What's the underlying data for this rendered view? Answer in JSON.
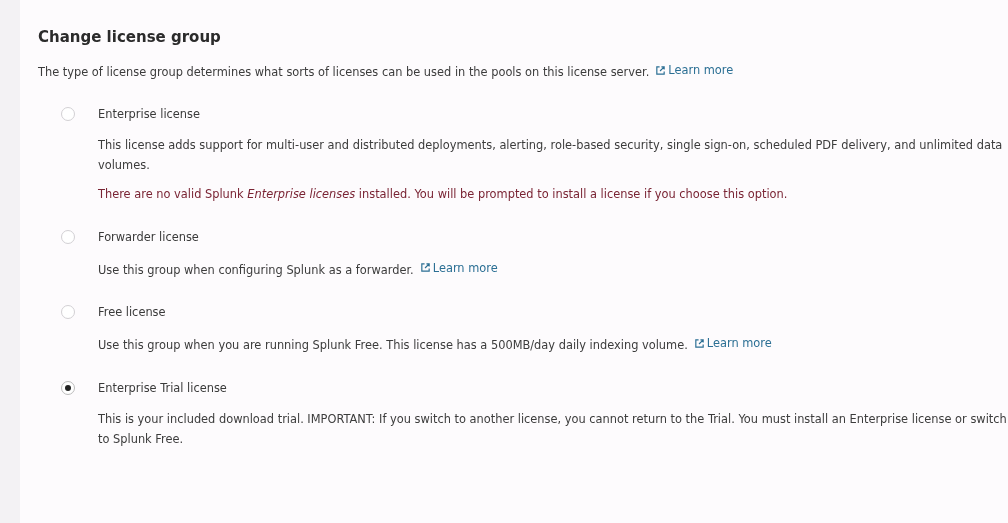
{
  "title": "Change license group",
  "intro": {
    "text": "The type of license group determines what sorts of licenses can be used in the pools on this license server.",
    "link": "Learn more"
  },
  "options": [
    {
      "label": "Enterprise license",
      "selected": false,
      "description": "This license adds support for multi-user and distributed deployments, alerting, role-based security, single sign-on, scheduled PDF delivery, and unlimited data volumes.",
      "warning": "There are no valid Splunk *Enterprise licenses* installed. You will be prompted to install a license if you choose this option."
    },
    {
      "label": "Forwarder license",
      "selected": false,
      "description": "Use this group when configuring Splunk as a forwarder.",
      "link": "Learn more"
    },
    {
      "label": "Free license",
      "selected": false,
      "description": "Use this group when you are running Splunk Free. This license has a 500MB/day daily indexing volume.",
      "link": "Learn more"
    },
    {
      "label": "Enterprise Trial license",
      "selected": true,
      "description": "This is your included download trial. IMPORTANT: If you switch to another license, you cannot return to the Trial. You must install an Enterprise license or switch to Splunk Free."
    }
  ]
}
